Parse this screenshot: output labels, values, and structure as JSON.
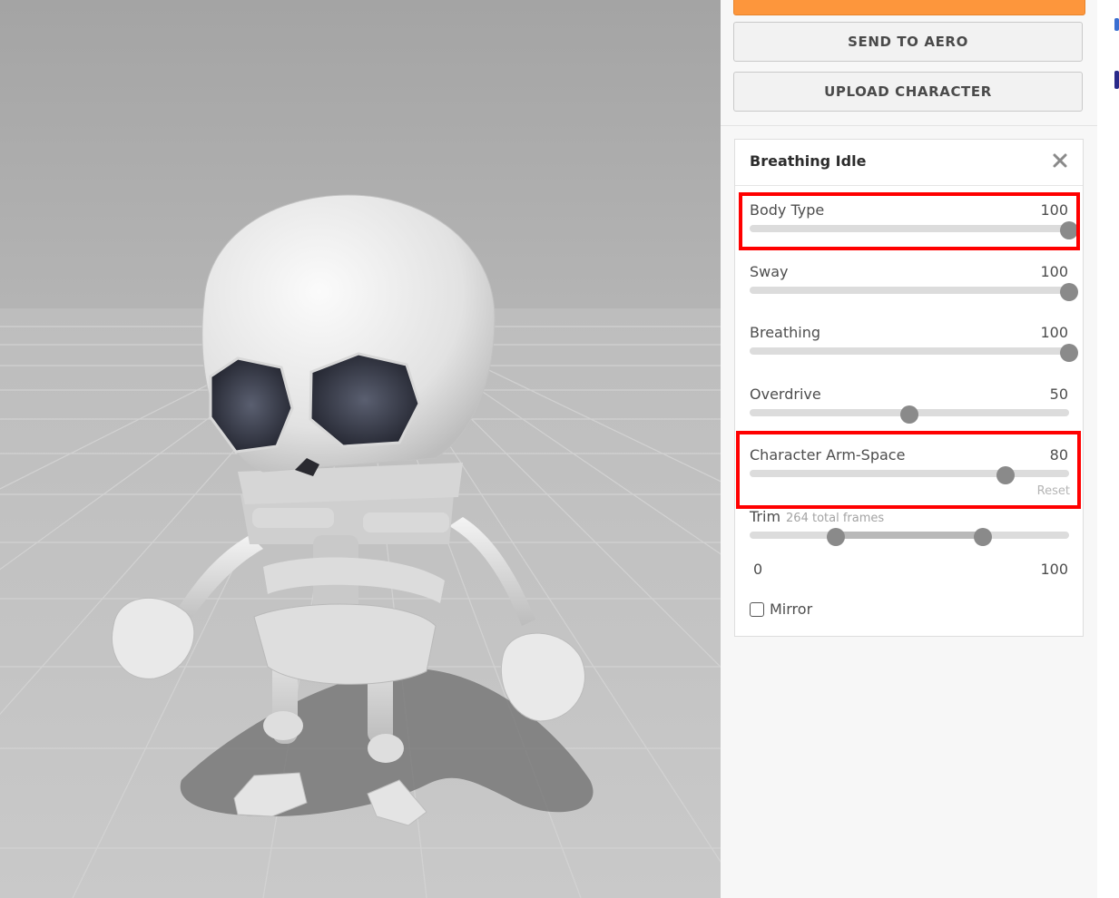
{
  "viewport": {
    "scene": "skeleton-character-3d-preview"
  },
  "panel": {
    "send_button": "SEND TO AERO",
    "upload_button": "UPLOAD CHARACTER",
    "card_title": "Breathing Idle",
    "close_icon": "close-icon",
    "sliders": [
      {
        "label": "Body Type",
        "value": "100",
        "fraction": 1.0
      },
      {
        "label": "Sway",
        "value": "100",
        "fraction": 1.0
      },
      {
        "label": "Breathing",
        "value": "100",
        "fraction": 1.0
      },
      {
        "label": "Overdrive",
        "value": "50",
        "fraction": 0.5
      },
      {
        "label": "Character Arm-Space",
        "value": "80",
        "fraction": 0.8,
        "reset": "Reset"
      }
    ],
    "trim": {
      "label": "Trim",
      "sublabel": "264 total frames",
      "min_label": "0",
      "max_label": "100",
      "start_fraction": 0.27,
      "end_fraction": 0.73
    },
    "mirror": {
      "label": "Mirror",
      "checked": false
    }
  },
  "colors": {
    "accent_orange": "#fd963c",
    "highlight_red": "#ff0000",
    "slider_thumb": "#8a8a8a"
  }
}
